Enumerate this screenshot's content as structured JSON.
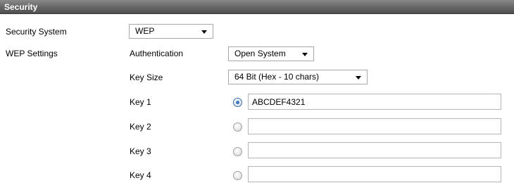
{
  "section": {
    "title": "Security"
  },
  "security_system": {
    "label": "Security System",
    "value": "WEP"
  },
  "wep_settings": {
    "label": "WEP Settings",
    "authentication": {
      "label": "Authentication",
      "value": "Open System"
    },
    "key_size": {
      "label": "Key Size",
      "value": "64 Bit (Hex - 10 chars)"
    },
    "keys": [
      {
        "label": "Key 1",
        "value": "ABCDEF4321",
        "selected": true
      },
      {
        "label": "Key 2",
        "value": "",
        "selected": false
      },
      {
        "label": "Key 3",
        "value": "",
        "selected": false
      },
      {
        "label": "Key 4",
        "value": "",
        "selected": false
      }
    ]
  },
  "colors": {
    "header_top": "#8a8a8a",
    "header_bottom": "#4f4f4f",
    "header_text": "#ffffff",
    "radio_selected": "#1f4f8f"
  }
}
